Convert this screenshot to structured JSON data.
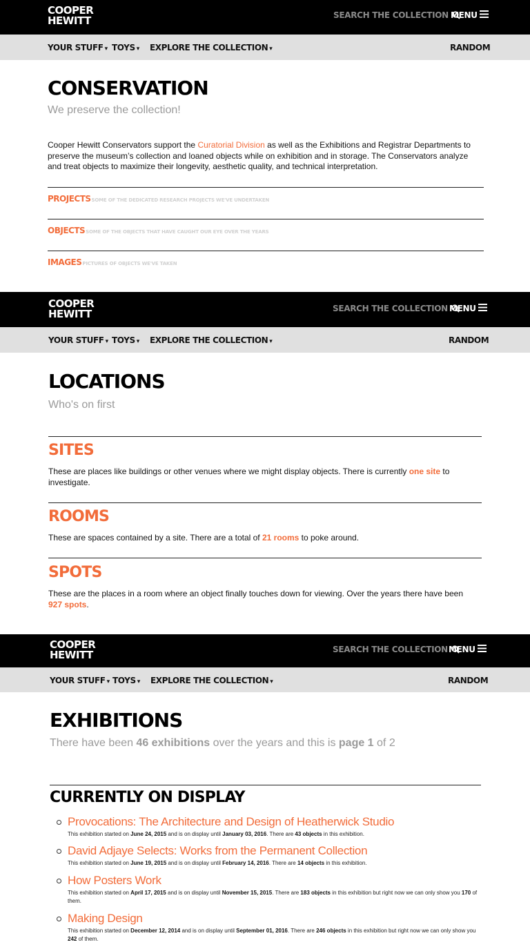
{
  "brand": {
    "logo_line1": "COOPER",
    "logo_line2": "HEWITT"
  },
  "header": {
    "search_label": "SEARCH THE COLLECTION",
    "menu_label": "MENU"
  },
  "subnav": {
    "your_stuff": "YOUR STUFF",
    "toys": "TOYS",
    "explore": "EXPLORE THE COLLECTION",
    "random": "RANDOM",
    "caret": "▾"
  },
  "conservation": {
    "title": "CONSERVATION",
    "subtitle": "We preserve the collection!",
    "intro_before": "Cooper Hewitt Conservators support the ",
    "intro_link": "Curatorial Division",
    "intro_after": " as well as the Exhibitions and Registrar Departments to preserve the museum’s collection and loaned objects while on exhibition and in storage. The Conservators analyze and treat objects to maximize their longevity, aesthetic quality, and technical interpretation.",
    "items": [
      {
        "label": "PROJECTS",
        "desc": "SOME OF THE DEDICATED RESEARCH PROJECTS WE'VE UNDERTAKEN"
      },
      {
        "label": "OBJECTS",
        "desc": "SOME OF THE OBJECTS THAT HAVE CAUGHT OUR EYE OVER THE YEARS"
      },
      {
        "label": "IMAGES",
        "desc": "PICTURES OF OBJECTS WE'VE TAKEN"
      }
    ]
  },
  "locations": {
    "title": "LOCATIONS",
    "subtitle": "Who's on first",
    "sites": {
      "heading": "SITES",
      "before": "These are places like buildings or other venues where we might display objects. There is currently ",
      "link": "one site",
      "after": " to investigate."
    },
    "rooms": {
      "heading": "ROOMS",
      "before": "These are spaces contained by a site. There are a total of ",
      "link": "21 rooms",
      "after": " to poke around."
    },
    "spots": {
      "heading": "SPOTS",
      "before": "These are the places in a room where an object finally touches down for viewing. Over the years there have been ",
      "link": "927 spots",
      "after": "."
    }
  },
  "exhibitions": {
    "title": "EXHIBITIONS",
    "sub_1": "There have been ",
    "count": "46 exhibitions",
    "sub_2": " over the years and this is ",
    "page": "page 1",
    "sub_3": " of 2",
    "section": "CURRENTLY ON DISPLAY",
    "items": [
      {
        "title": "Provocations: The Architecture and Design of Heatherwick Studio",
        "p1": "This exhibition started on ",
        "start": "June 24, 2015",
        "p2": " and is on display until ",
        "end": "January 03, 2016",
        "p3": ". There are ",
        "objects": "43 objects",
        "p4": " in this exhibition.",
        "p5": "",
        "shown": "",
        "p6": ""
      },
      {
        "title": "David Adjaye Selects: Works from the Permanent Collection",
        "p1": "This exhibition started on ",
        "start": "June 19, 2015",
        "p2": " and is on display until ",
        "end": "February 14, 2016",
        "p3": ". There are ",
        "objects": "14 objects",
        "p4": " in this exhibition.",
        "p5": "",
        "shown": "",
        "p6": ""
      },
      {
        "title": "How Posters Work",
        "p1": "This exhibition started on ",
        "start": "April 17, 2015",
        "p2": " and is on display until ",
        "end": "November 15, 2015",
        "p3": ". There are ",
        "objects": "183 objects",
        "p4": " in this exhibition but right now we can only show you ",
        "p5": "",
        "shown": "170",
        "p6": " of them."
      },
      {
        "title": "Making Design",
        "p1": "This exhibition started on ",
        "start": "December 12, 2014",
        "p2": " and is on display until ",
        "end": "September 01, 2016",
        "p3": ". There are ",
        "objects": "246 objects",
        "p4": " in this exhibition but right now we can only show you ",
        "p5": "",
        "shown": "242",
        "p6": " of them."
      }
    ]
  },
  "colors": {
    "accent": "#f26c3a",
    "header_bg": "#000000",
    "subnav_bg": "#e0e0e0",
    "muted": "#9a9a9a"
  }
}
